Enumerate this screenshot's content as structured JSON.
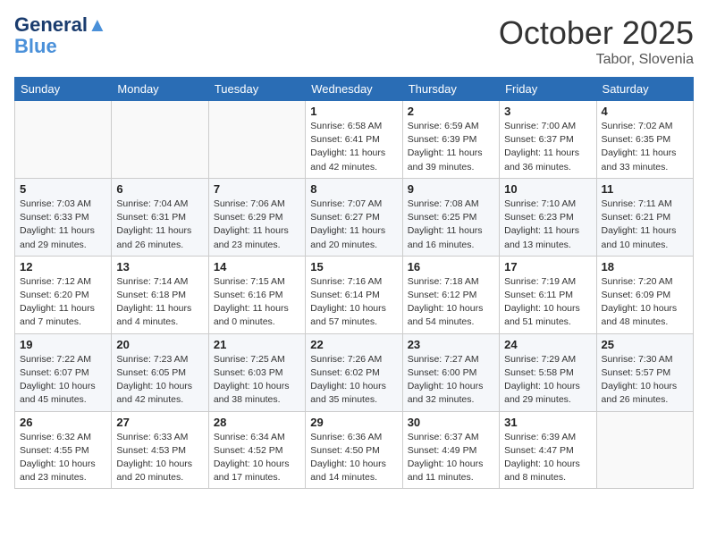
{
  "header": {
    "logo_line1": "General",
    "logo_line2": "Blue",
    "month": "October 2025",
    "location": "Tabor, Slovenia"
  },
  "weekdays": [
    "Sunday",
    "Monday",
    "Tuesday",
    "Wednesday",
    "Thursday",
    "Friday",
    "Saturday"
  ],
  "weeks": [
    [
      {
        "day": "",
        "info": ""
      },
      {
        "day": "",
        "info": ""
      },
      {
        "day": "",
        "info": ""
      },
      {
        "day": "1",
        "info": "Sunrise: 6:58 AM\nSunset: 6:41 PM\nDaylight: 11 hours and 42 minutes."
      },
      {
        "day": "2",
        "info": "Sunrise: 6:59 AM\nSunset: 6:39 PM\nDaylight: 11 hours and 39 minutes."
      },
      {
        "day": "3",
        "info": "Sunrise: 7:00 AM\nSunset: 6:37 PM\nDaylight: 11 hours and 36 minutes."
      },
      {
        "day": "4",
        "info": "Sunrise: 7:02 AM\nSunset: 6:35 PM\nDaylight: 11 hours and 33 minutes."
      }
    ],
    [
      {
        "day": "5",
        "info": "Sunrise: 7:03 AM\nSunset: 6:33 PM\nDaylight: 11 hours and 29 minutes."
      },
      {
        "day": "6",
        "info": "Sunrise: 7:04 AM\nSunset: 6:31 PM\nDaylight: 11 hours and 26 minutes."
      },
      {
        "day": "7",
        "info": "Sunrise: 7:06 AM\nSunset: 6:29 PM\nDaylight: 11 hours and 23 minutes."
      },
      {
        "day": "8",
        "info": "Sunrise: 7:07 AM\nSunset: 6:27 PM\nDaylight: 11 hours and 20 minutes."
      },
      {
        "day": "9",
        "info": "Sunrise: 7:08 AM\nSunset: 6:25 PM\nDaylight: 11 hours and 16 minutes."
      },
      {
        "day": "10",
        "info": "Sunrise: 7:10 AM\nSunset: 6:23 PM\nDaylight: 11 hours and 13 minutes."
      },
      {
        "day": "11",
        "info": "Sunrise: 7:11 AM\nSunset: 6:21 PM\nDaylight: 11 hours and 10 minutes."
      }
    ],
    [
      {
        "day": "12",
        "info": "Sunrise: 7:12 AM\nSunset: 6:20 PM\nDaylight: 11 hours and 7 minutes."
      },
      {
        "day": "13",
        "info": "Sunrise: 7:14 AM\nSunset: 6:18 PM\nDaylight: 11 hours and 4 minutes."
      },
      {
        "day": "14",
        "info": "Sunrise: 7:15 AM\nSunset: 6:16 PM\nDaylight: 11 hours and 0 minutes."
      },
      {
        "day": "15",
        "info": "Sunrise: 7:16 AM\nSunset: 6:14 PM\nDaylight: 10 hours and 57 minutes."
      },
      {
        "day": "16",
        "info": "Sunrise: 7:18 AM\nSunset: 6:12 PM\nDaylight: 10 hours and 54 minutes."
      },
      {
        "day": "17",
        "info": "Sunrise: 7:19 AM\nSunset: 6:11 PM\nDaylight: 10 hours and 51 minutes."
      },
      {
        "day": "18",
        "info": "Sunrise: 7:20 AM\nSunset: 6:09 PM\nDaylight: 10 hours and 48 minutes."
      }
    ],
    [
      {
        "day": "19",
        "info": "Sunrise: 7:22 AM\nSunset: 6:07 PM\nDaylight: 10 hours and 45 minutes."
      },
      {
        "day": "20",
        "info": "Sunrise: 7:23 AM\nSunset: 6:05 PM\nDaylight: 10 hours and 42 minutes."
      },
      {
        "day": "21",
        "info": "Sunrise: 7:25 AM\nSunset: 6:03 PM\nDaylight: 10 hours and 38 minutes."
      },
      {
        "day": "22",
        "info": "Sunrise: 7:26 AM\nSunset: 6:02 PM\nDaylight: 10 hours and 35 minutes."
      },
      {
        "day": "23",
        "info": "Sunrise: 7:27 AM\nSunset: 6:00 PM\nDaylight: 10 hours and 32 minutes."
      },
      {
        "day": "24",
        "info": "Sunrise: 7:29 AM\nSunset: 5:58 PM\nDaylight: 10 hours and 29 minutes."
      },
      {
        "day": "25",
        "info": "Sunrise: 7:30 AM\nSunset: 5:57 PM\nDaylight: 10 hours and 26 minutes."
      }
    ],
    [
      {
        "day": "26",
        "info": "Sunrise: 6:32 AM\nSunset: 4:55 PM\nDaylight: 10 hours and 23 minutes."
      },
      {
        "day": "27",
        "info": "Sunrise: 6:33 AM\nSunset: 4:53 PM\nDaylight: 10 hours and 20 minutes."
      },
      {
        "day": "28",
        "info": "Sunrise: 6:34 AM\nSunset: 4:52 PM\nDaylight: 10 hours and 17 minutes."
      },
      {
        "day": "29",
        "info": "Sunrise: 6:36 AM\nSunset: 4:50 PM\nDaylight: 10 hours and 14 minutes."
      },
      {
        "day": "30",
        "info": "Sunrise: 6:37 AM\nSunset: 4:49 PM\nDaylight: 10 hours and 11 minutes."
      },
      {
        "day": "31",
        "info": "Sunrise: 6:39 AM\nSunset: 4:47 PM\nDaylight: 10 hours and 8 minutes."
      },
      {
        "day": "",
        "info": ""
      }
    ]
  ]
}
